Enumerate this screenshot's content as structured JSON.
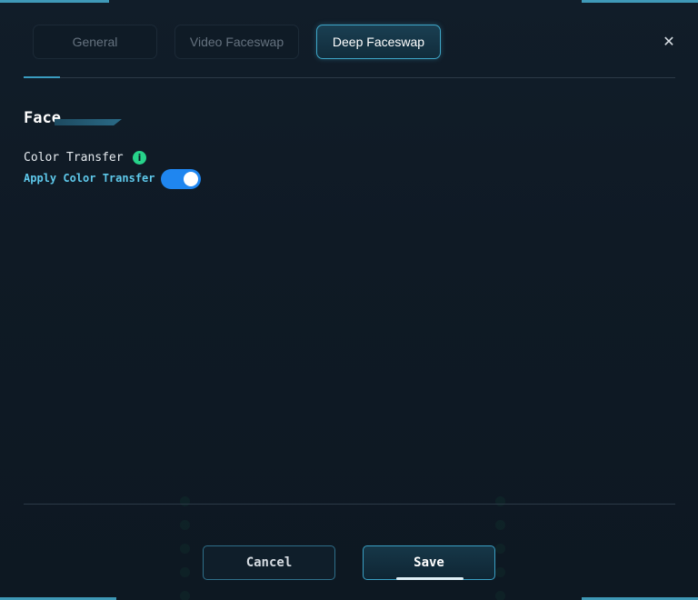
{
  "tabs": [
    {
      "label": "General",
      "active": false
    },
    {
      "label": "Video Faceswap",
      "active": false
    },
    {
      "label": "Deep Faceswap",
      "active": true
    }
  ],
  "close_icon": "close-icon",
  "section": {
    "title": "Face",
    "setting_label": "Color Transfer",
    "info_icon": "info-icon",
    "option_label": "Apply Color Transfer",
    "toggle_on": true
  },
  "buttons": {
    "cancel": "Cancel",
    "save": "Save"
  },
  "colors": {
    "accent": "#3fa7c9",
    "toggle": "#1f86f0",
    "info": "#27d38a",
    "option_label": "#5ec8ea"
  }
}
